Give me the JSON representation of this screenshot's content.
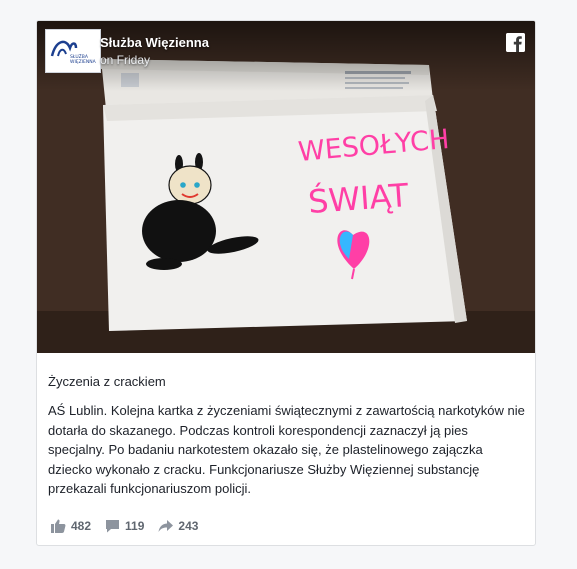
{
  "post": {
    "page_name": "Służba Więzienna",
    "time": "on Friday",
    "title": "Życzenia z crackiem",
    "text": "AŚ Lublin. Kolejna kartka z życzeniami świątecznymi z zawartością narkotyków nie dotarła do skazanego. Podczas kontroli korespondencji zaznaczył ją pies specjalny. Po badaniu narkotestem okazało się, że plastelinowego zajączka dziecko wykonało z cracku. Funkcjonariusze Służby Więziennej substancję przekazali funkcjonariuszom policji."
  },
  "logo": {
    "line1": "SŁUŻBA",
    "line2": "WIĘZIENNA"
  },
  "photo": {
    "card_text_line1": "WESOŁYCH",
    "card_text_line2": "ŚWIĄT"
  },
  "stats": {
    "likes": "482",
    "comments": "119",
    "shares": "243"
  },
  "icons": {
    "brand": "facebook-icon",
    "like": "thumbs-up-icon",
    "comment": "comment-icon",
    "share": "share-icon"
  },
  "colors": {
    "marker_pink": "#ff3fa6",
    "link_gray": "#606770"
  }
}
